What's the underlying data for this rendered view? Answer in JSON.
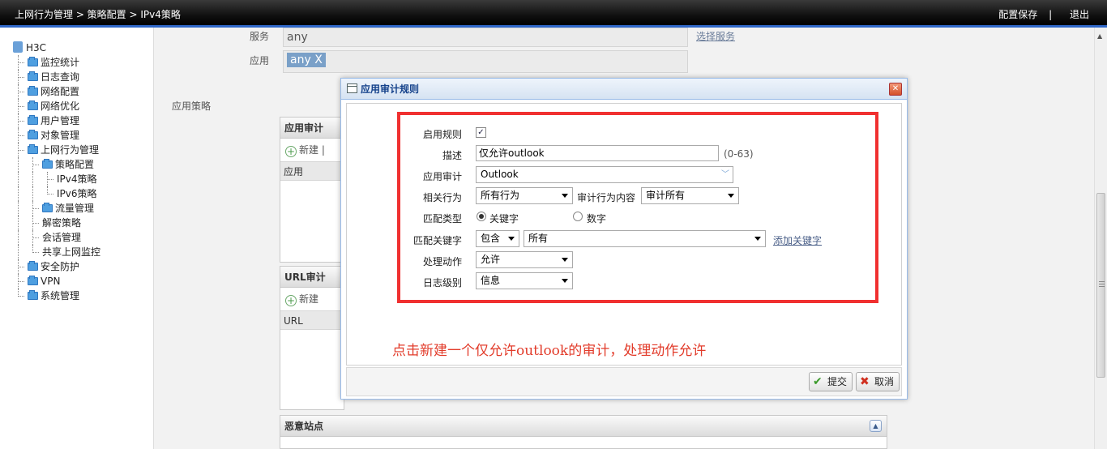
{
  "topbar": {
    "breadcrumb": "上网行为管理 > 策略配置 > IPv4策略",
    "save_config": "配置保存",
    "separator": "|",
    "logout": "退出"
  },
  "sidebar": {
    "root": "H3C",
    "items": [
      {
        "label": "监控统计"
      },
      {
        "label": "日志查询"
      },
      {
        "label": "网络配置"
      },
      {
        "label": "网络优化"
      },
      {
        "label": "用户管理"
      },
      {
        "label": "对象管理"
      },
      {
        "label": "上网行为管理"
      },
      {
        "label": "策略配置"
      },
      {
        "label": "IPv4策略"
      },
      {
        "label": "IPv6策略"
      },
      {
        "label": "流量管理"
      },
      {
        "label": "解密策略"
      },
      {
        "label": "会话管理"
      },
      {
        "label": "共享上网监控"
      },
      {
        "label": "安全防护"
      },
      {
        "label": "VPN"
      },
      {
        "label": "系统管理"
      }
    ]
  },
  "main": {
    "service_label": "服务",
    "service_value": "any",
    "select_service_link": "选择服务",
    "app_label": "应用",
    "app_tag": "any X",
    "app_policy_label": "应用策略",
    "app_audit_panel": {
      "title": "应用审计",
      "new_button": "新建 |",
      "column": "应用"
    },
    "url_audit_panel": {
      "title": "URL审计",
      "new_button": "新建",
      "column": "URL"
    },
    "malicious_panel": {
      "title": "恶意站点"
    }
  },
  "dialog": {
    "title": "应用审计规则",
    "close": "✕",
    "enable_label": "启用规则",
    "enable_checked": true,
    "desc_label": "描述",
    "desc_value": "仅允许outlook",
    "desc_hint": "(0-63)",
    "audit_label": "应用审计",
    "audit_value": "Outlook",
    "behavior_label": "相关行为",
    "behavior_value": "所有行为",
    "audit_content_label": "审计行为内容",
    "audit_content_value": "审计所有",
    "match_type_label": "匹配类型",
    "match_keyword": "关键字",
    "match_number": "数字",
    "match_selected": "关键字",
    "match_kw_label": "匹配关键字",
    "match_op": "包含",
    "match_kw_value": "所有",
    "add_keyword_link": "添加关键字",
    "action_label": "处理动作",
    "action_value": "允许",
    "log_label": "日志级别",
    "log_value": "信息",
    "annotation": "点击新建一个仅允许outlook的审计，处理动作允许",
    "submit": "提交",
    "cancel": "取消"
  },
  "colors": {
    "highlight_border": "#f03030",
    "annotation": "#e23b2a",
    "topbar_accent": "#2f67c8"
  }
}
